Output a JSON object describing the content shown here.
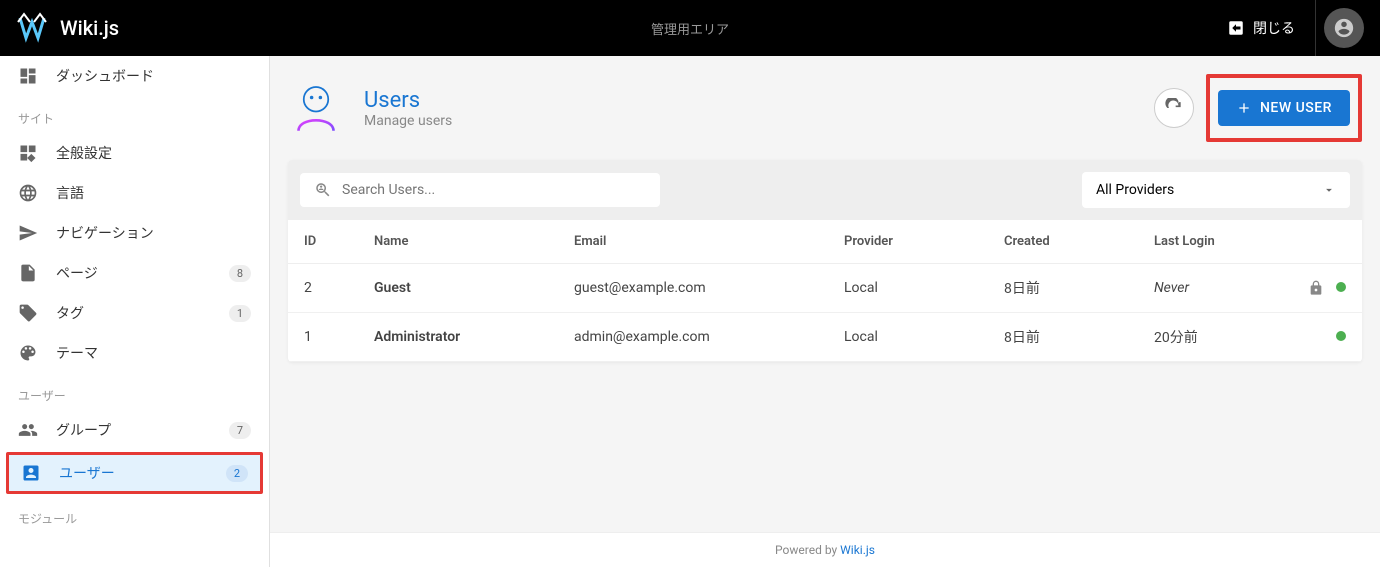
{
  "header": {
    "brand": "Wiki.js",
    "center": "管理用エリア",
    "close": "閉じる"
  },
  "sidebar": {
    "dashboard": "ダッシュボード",
    "section_site": "サイト",
    "general": "全般設定",
    "language": "言語",
    "navigation": "ナビゲーション",
    "pages": "ページ",
    "pages_badge": "8",
    "tags": "タグ",
    "tags_badge": "1",
    "theme": "テーマ",
    "section_users": "ユーザー",
    "groups": "グループ",
    "groups_badge": "7",
    "users": "ユーザー",
    "users_badge": "2",
    "section_modules": "モジュール"
  },
  "page": {
    "title": "Users",
    "subtitle": "Manage users",
    "new_user": "NEW USER"
  },
  "filters": {
    "search_placeholder": "Search Users...",
    "provider": "All Providers"
  },
  "table": {
    "headers": {
      "id": "ID",
      "name": "Name",
      "email": "Email",
      "provider": "Provider",
      "created": "Created",
      "last_login": "Last Login"
    },
    "rows": [
      {
        "id": "2",
        "name": "Guest",
        "email": "guest@example.com",
        "provider": "Local",
        "created": "8日前",
        "last_login": "Never",
        "last_login_italic": true,
        "locked": true,
        "dot": "#4caf50"
      },
      {
        "id": "1",
        "name": "Administrator",
        "email": "admin@example.com",
        "provider": "Local",
        "created": "8日前",
        "last_login": "20分前",
        "last_login_italic": false,
        "locked": false,
        "dot": "#4caf50"
      }
    ]
  },
  "footer": {
    "powered_by": "Powered by ",
    "link": "Wiki.js"
  }
}
